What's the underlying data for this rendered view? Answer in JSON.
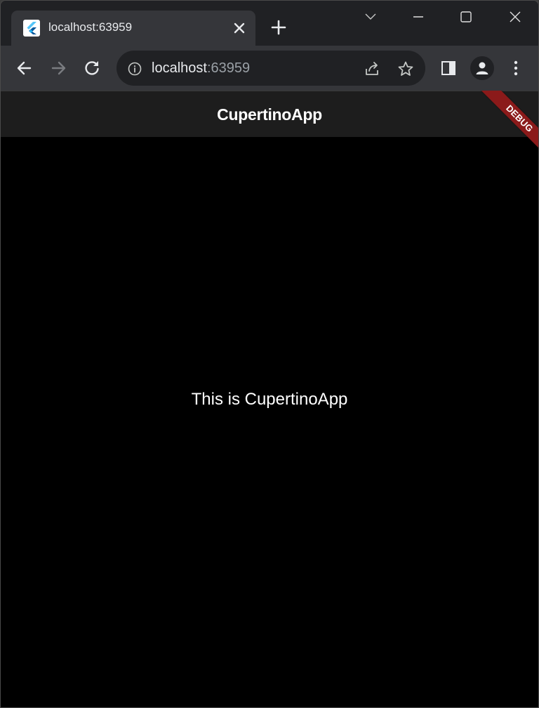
{
  "browser": {
    "tab": {
      "title": "localhost:63959",
      "favicon": "flutter-icon"
    },
    "address_bar": {
      "host": "localhost",
      "port": ":63959"
    },
    "icons": {
      "back": "arrow-left-icon",
      "forward": "arrow-right-icon",
      "reload": "reload-icon",
      "info": "info-icon",
      "share": "share-icon",
      "bookmark": "star-icon",
      "side_panel": "side-panel-icon",
      "profile": "profile-icon",
      "menu": "more-vert-icon"
    },
    "window_controls": [
      "tab-search",
      "minimize",
      "maximize",
      "close"
    ]
  },
  "app": {
    "nav_title": "CupertinoApp",
    "body_text": "This is CupertinoApp",
    "debug_banner": "DEBUG"
  },
  "colors": {
    "browser_frame": "#202124",
    "toolbar": "#35363a",
    "navbar": "#1d1d1d",
    "page_background": "#000000",
    "debug_banner": "#8b1a1a"
  }
}
